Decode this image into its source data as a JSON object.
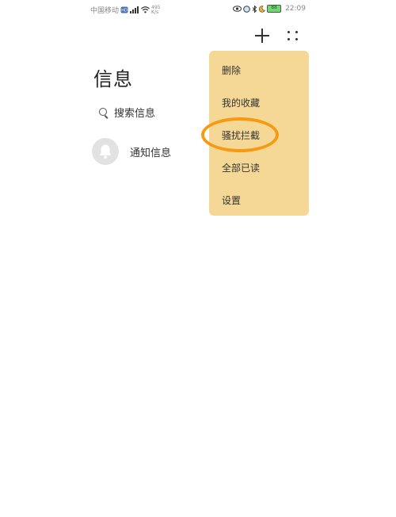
{
  "status_bar": {
    "carrier": "中国移动",
    "net_speed_value": "495",
    "net_speed_unit": "K/s",
    "battery": "88",
    "time": "22:09"
  },
  "header": {
    "title": "信息"
  },
  "search": {
    "placeholder": "搜索信息"
  },
  "conversations": [
    {
      "label": "通知信息",
      "icon": "bell-icon"
    }
  ],
  "menu": {
    "items": [
      {
        "label": "删除"
      },
      {
        "label": "我的收藏"
      },
      {
        "label": "骚扰拦截"
      },
      {
        "label": "全部已读"
      },
      {
        "label": "设置"
      }
    ],
    "highlighted_index": 2
  },
  "colors": {
    "menu_background": "#f6d896",
    "highlight_ring": "#f59a12",
    "avatar_background": "#e2e2e2"
  }
}
